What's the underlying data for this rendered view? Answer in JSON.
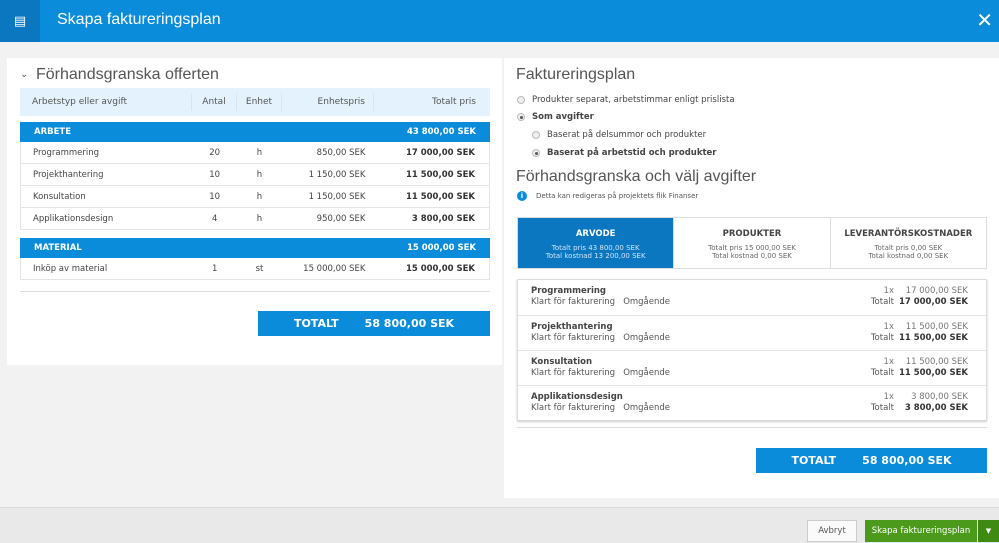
{
  "header": {
    "title": "Skapa faktureringsplan"
  },
  "left": {
    "title": "Förhandsgranska offerten",
    "columns": [
      "Arbetstyp eller avgift",
      "Antal",
      "Enhet",
      "Enhetspris",
      "Totalt pris"
    ],
    "groups": [
      {
        "name": "ARBETE",
        "total": "43 800,00 SEK",
        "rows": [
          [
            "Programmering",
            "20",
            "h",
            "850,00 SEK",
            "17 000,00 SEK"
          ],
          [
            "Projekthantering",
            "10",
            "h",
            "1 150,00 SEK",
            "11 500,00 SEK"
          ],
          [
            "Konsultation",
            "10",
            "h",
            "1 150,00 SEK",
            "11 500,00 SEK"
          ],
          [
            "Applikationsdesign",
            "4",
            "h",
            "950,00 SEK",
            "3 800,00 SEK"
          ]
        ]
      },
      {
        "name": "MATERIAL",
        "total": "15 000,00 SEK",
        "rows": [
          [
            "Inköp av material",
            "1",
            "st",
            "15 000,00 SEK",
            "15 000,00 SEK"
          ]
        ]
      }
    ],
    "total_label": "TOTALT",
    "total_value": "58 800,00 SEK"
  },
  "right": {
    "title": "Faktureringsplan",
    "options": {
      "o1": "Produkter separat, arbetstimmar enligt prislista",
      "o2": "Som avgifter",
      "o3": "Baserat på delsummor och produkter",
      "o4": "Baserat på arbetstid och produkter"
    },
    "section_title": "Förhandsgranska och välj avgifter",
    "info": "Detta kan redigeras på projektets flik Finanser",
    "tabs": [
      {
        "label": "ARVODE",
        "price": "Totalt pris 43 800,00 SEK",
        "cost": "Total kostnad 13 200,00 SEK"
      },
      {
        "label": "PRODUKTER",
        "price": "Totalt pris 15 000,00 SEK",
        "cost": "Total kostnad 0,00 SEK"
      },
      {
        "label": "LEVERANTÖRSKOSTNADER",
        "price": "Totalt pris 0,00 SEK",
        "cost": "Total kostnad 0,00 SEK"
      }
    ],
    "items": [
      {
        "name": "Programmering",
        "status": "Klart för fakturering   Omgående",
        "qty": "1x",
        "total_label": "Totalt",
        "price": "17 000,00 SEK",
        "total": "17 000,00 SEK"
      },
      {
        "name": "Projekthantering",
        "status": "Klart för fakturering   Omgående",
        "qty": "1x",
        "total_label": "Totalt",
        "price": "11 500,00 SEK",
        "total": "11 500,00 SEK"
      },
      {
        "name": "Konsultation",
        "status": "Klart för fakturering   Omgående",
        "qty": "1x",
        "total_label": "Totalt",
        "price": "11 500,00 SEK",
        "total": "11 500,00 SEK"
      },
      {
        "name": "Applikationsdesign",
        "status": "Klart för fakturering   Omgående",
        "qty": "1x",
        "total_label": "Totalt",
        "price": "3 800,00 SEK",
        "total": "3 800,00 SEK"
      }
    ],
    "total_label": "TOTALT",
    "total_value": "58 800,00 SEK"
  },
  "footer": {
    "cancel": "Avbryt",
    "create": "Skapa faktureringsplan"
  },
  "colors": {
    "primary": "#0a8cdb",
    "green": "#4c9a1c"
  }
}
